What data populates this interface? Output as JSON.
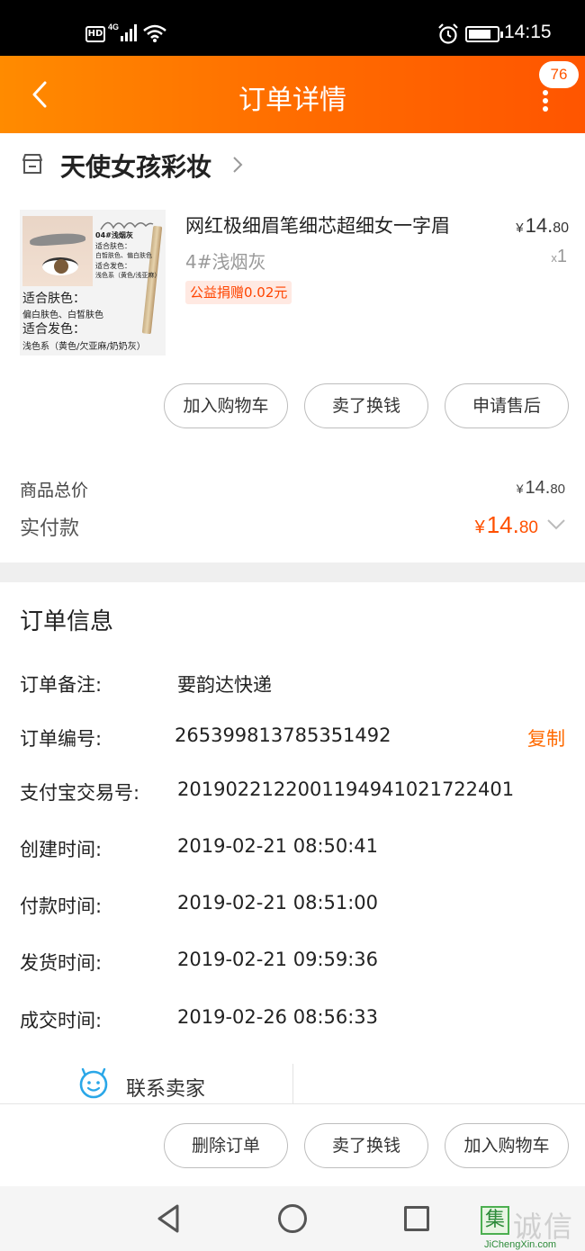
{
  "status_bar": {
    "hd_label": "HD",
    "network": "4G",
    "time": "14:15"
  },
  "header": {
    "title": "订单详情",
    "message_badge": "76"
  },
  "shop": {
    "name": "天使女孩彩妆"
  },
  "product": {
    "image_text": {
      "shade": "04#浅烟灰",
      "skin_label_small": "适合肤色：",
      "skin_value_small": "白皙肤色、偏白肤色",
      "hair_label_small": "适合发色：",
      "hair_value_small": "浅色系（黄色/浅亚麻）",
      "skin_label": "适合肤色：",
      "skin_value": "偏白肤色、白皙肤色",
      "hair_label": "适合发色：",
      "hair_value": "浅色系（黄色/欠亚麻/奶奶灰）"
    },
    "name": "网红极细眉笔细芯超细女一字眉",
    "sku": "4#浅烟灰",
    "tag": "公益捐赠0.02元",
    "price_currency": "¥",
    "price_int": "14.",
    "price_dec": "80",
    "qty_prefix": "x",
    "qty": "1"
  },
  "item_actions": {
    "add_cart": "加入购物车",
    "resell": "卖了换钱",
    "after_sale": "申请售后"
  },
  "totals": {
    "goods_total_label": "商品总价",
    "goods_total_currency": "¥",
    "goods_total_int": "14.",
    "goods_total_dec": "80",
    "paid_label": "实付款",
    "paid_currency": "¥",
    "paid_int": "14.",
    "paid_dec": "80"
  },
  "order_info": {
    "title": "订单信息",
    "copy_label": "复制",
    "rows": [
      {
        "label": "订单备注:",
        "value": "要韵达快递"
      },
      {
        "label": "订单编号:",
        "value": "265399813785351492"
      },
      {
        "label": "支付宝交易号:",
        "value": "2019022122001194941021722401"
      },
      {
        "label": "创建时间:",
        "value": "2019-02-21 08:50:41"
      },
      {
        "label": "付款时间:",
        "value": "2019-02-21 08:51:00"
      },
      {
        "label": "发货时间:",
        "value": "2019-02-21 09:59:36"
      },
      {
        "label": "成交时间:",
        "value": "2019-02-26 08:56:33"
      }
    ]
  },
  "contact": {
    "label": "联系卖家"
  },
  "bottom_actions": {
    "delete_order": "删除订单",
    "resell": "卖了换钱",
    "add_cart": "加入购物车"
  },
  "watermark": {
    "glyph": "集",
    "text": "诚信",
    "sub": "JiChengXin.com"
  },
  "colors": {
    "header_start": "#ff8b00",
    "header_end": "#ff5500",
    "accent": "#ff5000",
    "tag_bg": "#ffe9e2"
  }
}
